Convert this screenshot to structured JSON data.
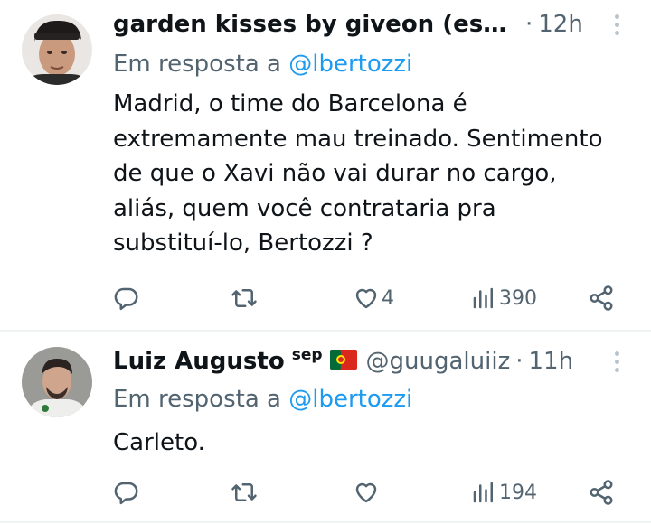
{
  "tweets": [
    {
      "display_name": "garden kisses by giveon (essa...",
      "handle": "",
      "time": "12h",
      "reply_prefix": "Em resposta a",
      "reply_to": "@lbertozzi",
      "body": "Madrid, o time do Barcelona é\nextremamente mau treinado. Sentimento\nde que o Xavi não vai durar no cargo,\naliás, quem você contrataria pra\nsubstituí-lo, Bertozzi ?",
      "likes": "4",
      "views": "390"
    },
    {
      "display_name": "Luiz Augusto",
      "name_suffix": "sep",
      "flag": "portugal-flag",
      "handle": "@guugaluiiz",
      "time": "11h",
      "reply_prefix": "Em resposta a",
      "reply_to": "@lbertozzi",
      "body": "Carleto.",
      "likes": "",
      "views": "194"
    }
  ],
  "colors": {
    "text": "#0f1419",
    "secondary": "#536471",
    "link": "#1d9bf0",
    "divider": "#eff3f4"
  },
  "icons": [
    "reply-icon",
    "retweet-icon",
    "like-icon",
    "views-icon",
    "share-icon",
    "more-icon"
  ]
}
